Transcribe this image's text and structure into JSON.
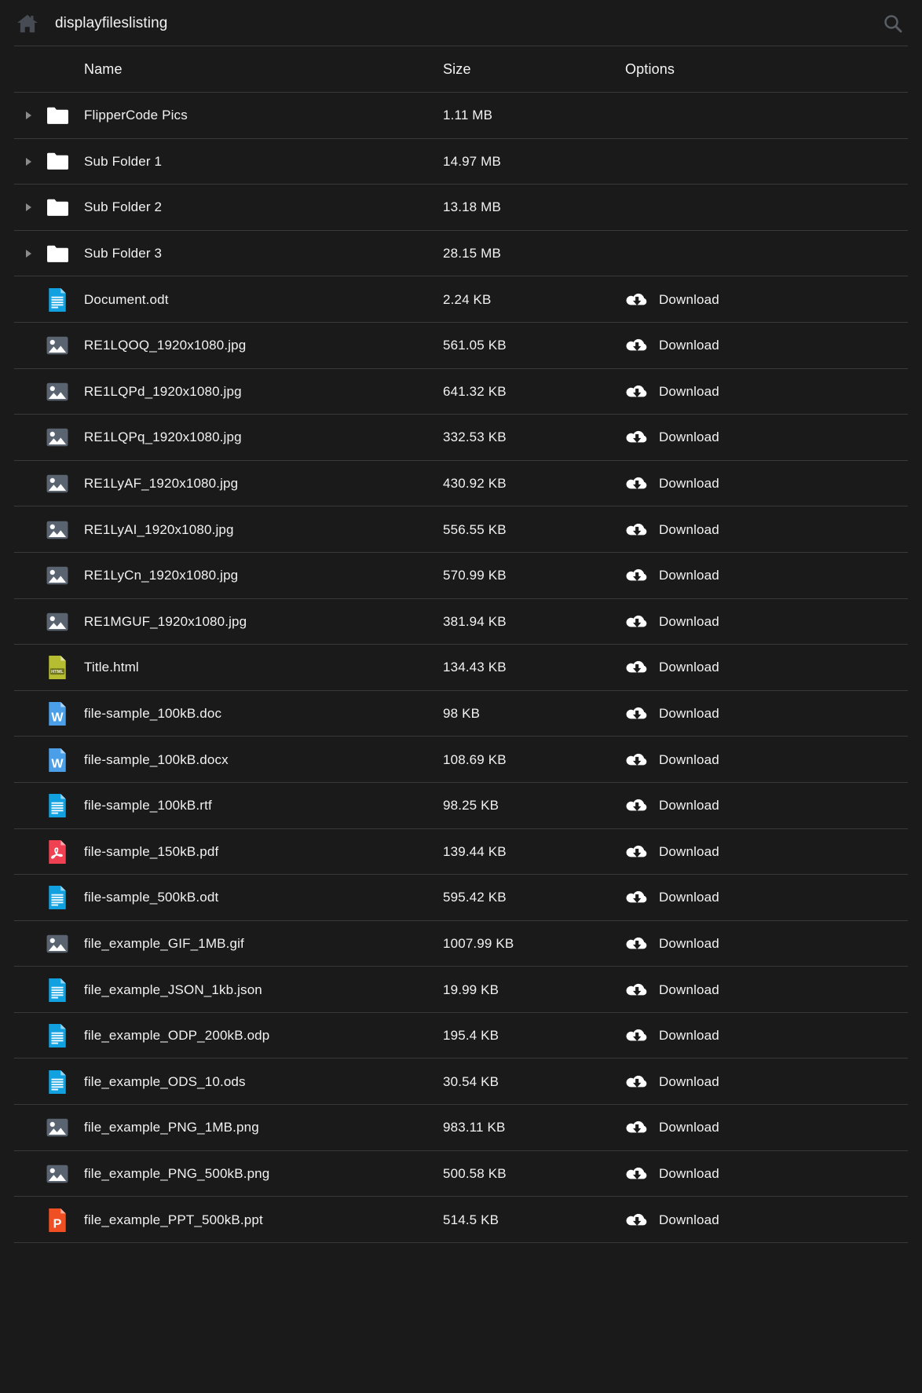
{
  "header": {
    "home_icon": "home-icon",
    "title": "displayfileslisting",
    "search_icon": "search-icon"
  },
  "columns": {
    "name": "Name",
    "size": "Size",
    "options": "Options"
  },
  "download_label": "Download",
  "colors": {
    "background": "#1a1a1a",
    "divider": "#3a3a3a",
    "text": "#f2f2f2",
    "folder": "#ffffff",
    "doc_blue": "#12a1e0",
    "word_blue": "#4a9fe8",
    "pdf_red": "#ef4152",
    "html_olive": "#b6bd30",
    "ppt_orange": "#f04e23",
    "image_grey": "#5a6370",
    "arrow_grey": "#8b8b8b",
    "home_grey": "#474c54",
    "search_grey": "#5a5f66"
  },
  "rows": [
    {
      "expandable": true,
      "icon": "folder-icon",
      "name": "FlipperCode Pics",
      "size": "1.11 MB",
      "download": false
    },
    {
      "expandable": true,
      "icon": "folder-icon",
      "name": "Sub Folder 1",
      "size": "14.97 MB",
      "download": false
    },
    {
      "expandable": true,
      "icon": "folder-icon",
      "name": "Sub Folder 2",
      "size": "13.18 MB",
      "download": false
    },
    {
      "expandable": true,
      "icon": "folder-icon",
      "name": "Sub Folder 3",
      "size": "28.15 MB",
      "download": false
    },
    {
      "expandable": false,
      "icon": "document-icon",
      "name": "Document.odt",
      "size": "2.24 KB",
      "download": true
    },
    {
      "expandable": false,
      "icon": "image-icon",
      "name": "RE1LQOQ_1920x1080.jpg",
      "size": "561.05 KB",
      "download": true
    },
    {
      "expandable": false,
      "icon": "image-icon",
      "name": "RE1LQPd_1920x1080.jpg",
      "size": "641.32 KB",
      "download": true
    },
    {
      "expandable": false,
      "icon": "image-icon",
      "name": "RE1LQPq_1920x1080.jpg",
      "size": "332.53 KB",
      "download": true
    },
    {
      "expandable": false,
      "icon": "image-icon",
      "name": "RE1LyAF_1920x1080.jpg",
      "size": "430.92 KB",
      "download": true
    },
    {
      "expandable": false,
      "icon": "image-icon",
      "name": "RE1LyAI_1920x1080.jpg",
      "size": "556.55 KB",
      "download": true
    },
    {
      "expandable": false,
      "icon": "image-icon",
      "name": "RE1LyCn_1920x1080.jpg",
      "size": "570.99 KB",
      "download": true
    },
    {
      "expandable": false,
      "icon": "image-icon",
      "name": "RE1MGUF_1920x1080.jpg",
      "size": "381.94 KB",
      "download": true
    },
    {
      "expandable": false,
      "icon": "html-icon",
      "name": "Title.html",
      "size": "134.43 KB",
      "download": true
    },
    {
      "expandable": false,
      "icon": "word-icon",
      "name": "file-sample_100kB.doc",
      "size": "98 KB",
      "download": true
    },
    {
      "expandable": false,
      "icon": "word-icon",
      "name": "file-sample_100kB.docx",
      "size": "108.69 KB",
      "download": true
    },
    {
      "expandable": false,
      "icon": "document-icon",
      "name": "file-sample_100kB.rtf",
      "size": "98.25 KB",
      "download": true
    },
    {
      "expandable": false,
      "icon": "pdf-icon",
      "name": "file-sample_150kB.pdf",
      "size": "139.44 KB",
      "download": true
    },
    {
      "expandable": false,
      "icon": "document-icon",
      "name": "file-sample_500kB.odt",
      "size": "595.42 KB",
      "download": true
    },
    {
      "expandable": false,
      "icon": "image-icon",
      "name": "file_example_GIF_1MB.gif",
      "size": "1007.99 KB",
      "download": true
    },
    {
      "expandable": false,
      "icon": "document-icon",
      "name": "file_example_JSON_1kb.json",
      "size": "19.99 KB",
      "download": true
    },
    {
      "expandable": false,
      "icon": "document-icon",
      "name": "file_example_ODP_200kB.odp",
      "size": "195.4 KB",
      "download": true
    },
    {
      "expandable": false,
      "icon": "document-icon",
      "name": "file_example_ODS_10.ods",
      "size": "30.54 KB",
      "download": true
    },
    {
      "expandable": false,
      "icon": "image-icon",
      "name": "file_example_PNG_1MB.png",
      "size": "983.11 KB",
      "download": true
    },
    {
      "expandable": false,
      "icon": "image-icon",
      "name": "file_example_PNG_500kB.png",
      "size": "500.58 KB",
      "download": true
    },
    {
      "expandable": false,
      "icon": "ppt-icon",
      "name": "file_example_PPT_500kB.ppt",
      "size": "514.5 KB",
      "download": true
    }
  ]
}
